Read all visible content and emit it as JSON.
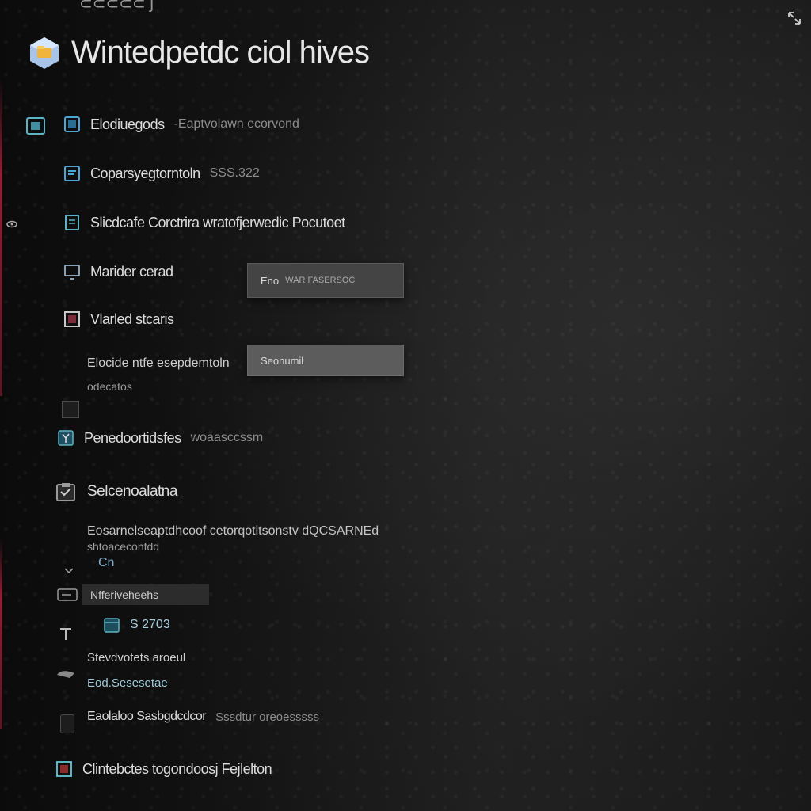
{
  "app": {
    "title": "Wintedpetdc ciol hives",
    "top_fragment": "⊂⊂⊂⊂⊂ ʃ"
  },
  "items": [
    {
      "label": "Elodiuegods",
      "meta": "-Eaptvolawn ecorvond"
    },
    {
      "label": "Coparsyegtorntoln",
      "meta": "SSS.322"
    },
    {
      "label": "Slicdcafe Corctrira wratofjerwedic Pocutoet"
    },
    {
      "label": "Marider cerad"
    },
    {
      "label": "Vlarled stcaris"
    }
  ],
  "dropdown": {
    "top_label": "Eno",
    "top_meta": "WAR FASERSOC",
    "selected_label": "Seonumil"
  },
  "fields": {
    "explain": "Elocide ntfe esepdemtoln",
    "explain_sub": "odecatos"
  },
  "presence": {
    "label": "Penedoortidsfes",
    "meta": "woaasccssm"
  },
  "schema": {
    "label": "Selcenoalatna",
    "description": "Eosarnelseaptdhcoof cetorqotitsonstv dQCSARNEd",
    "description_2": "shtoaceconfdd",
    "tag": "Cn"
  },
  "shortcut": {
    "label": "Nfferiveheehs",
    "value": "S 2703"
  },
  "info": {
    "line1": "Stevdvotets aroeul",
    "line2": "Eod.Sesesetae",
    "line3_label": "Eaolaloo Sasbgdcdcor",
    "line3_meta": "Sssdtur oreoesssss"
  },
  "footer": {
    "label": "Clintebctes togondoosj Fejlelton"
  }
}
